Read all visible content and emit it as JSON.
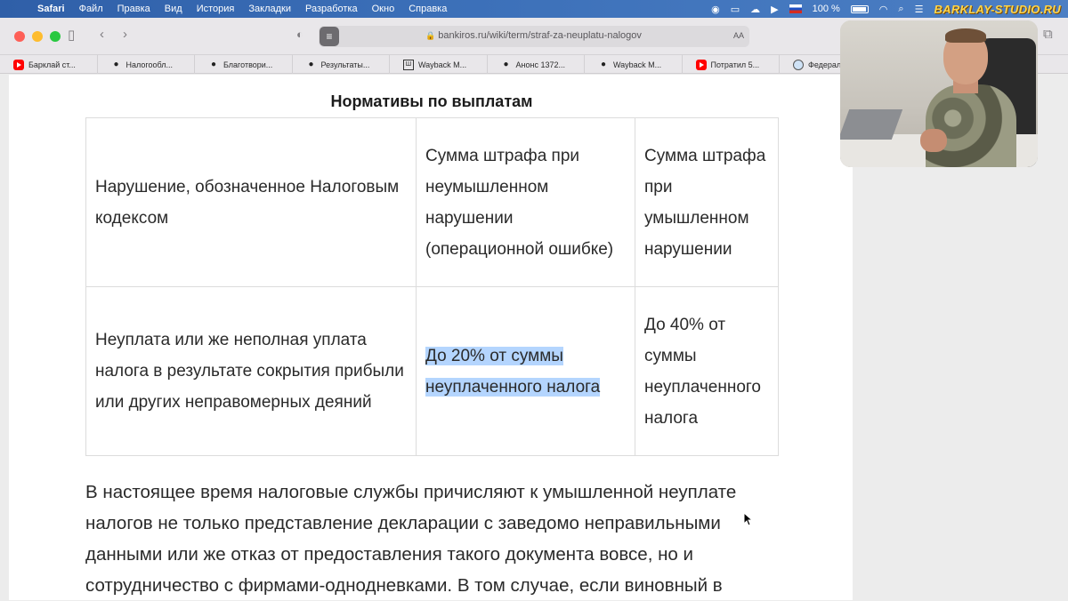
{
  "menubar": {
    "apple_icon": "apple-logo-icon",
    "items": [
      "Safari",
      "Файл",
      "Правка",
      "Вид",
      "История",
      "Закладки",
      "Разработка",
      "Окно",
      "Справка"
    ],
    "battery_text": "100 %",
    "brand": "BARKLAY-STUDIO.RU"
  },
  "toolbar": {
    "url": "bankiros.ru/wiki/term/straf-za-neuplatu-nalogov",
    "reader_aa": "AA"
  },
  "bookmarks": [
    {
      "icon": "youtube-icon",
      "label": "Барклай ст..."
    },
    {
      "icon": "drop-icon",
      "label": "Налогообл..."
    },
    {
      "icon": "drop-icon",
      "label": "Благотвори..."
    },
    {
      "icon": "drop-icon",
      "label": "Результаты..."
    },
    {
      "icon": "wayback-icon",
      "label": "Wayback M..."
    },
    {
      "icon": "drop-icon",
      "label": "Анонс 1372..."
    },
    {
      "icon": "drop-icon",
      "label": "Wayback M..."
    },
    {
      "icon": "youtube-icon",
      "label": "Потратил 5..."
    },
    {
      "icon": "globe-icon",
      "label": "Федеральн..."
    }
  ],
  "article": {
    "table_title": "Нормативы по выплатам",
    "header": {
      "col1": "Нарушение, обозначенное Налоговым кодексом",
      "col2": "Сумма штрафа при неумышленном нарушении (операционной ошибке)",
      "col3": "Сумма штрафа при умышленном нарушении"
    },
    "row": {
      "col1": "Неуплата или же неполная уплата налога в результате сокрытия прибыли или других неправомерных деяний",
      "col2": "До 20% от суммы неуплаченного налога",
      "col3": "До 40% от суммы неуплаченного налога"
    },
    "paragraph": "В настоящее время налоговые службы причисляют к умышленной неуплате налогов не только представление декларации с заведомо неправильными данными или же отказ от предоставления такого документа вовсе, но и сотрудничество с фирмами-однодневками. В том случае, если виновный в"
  }
}
